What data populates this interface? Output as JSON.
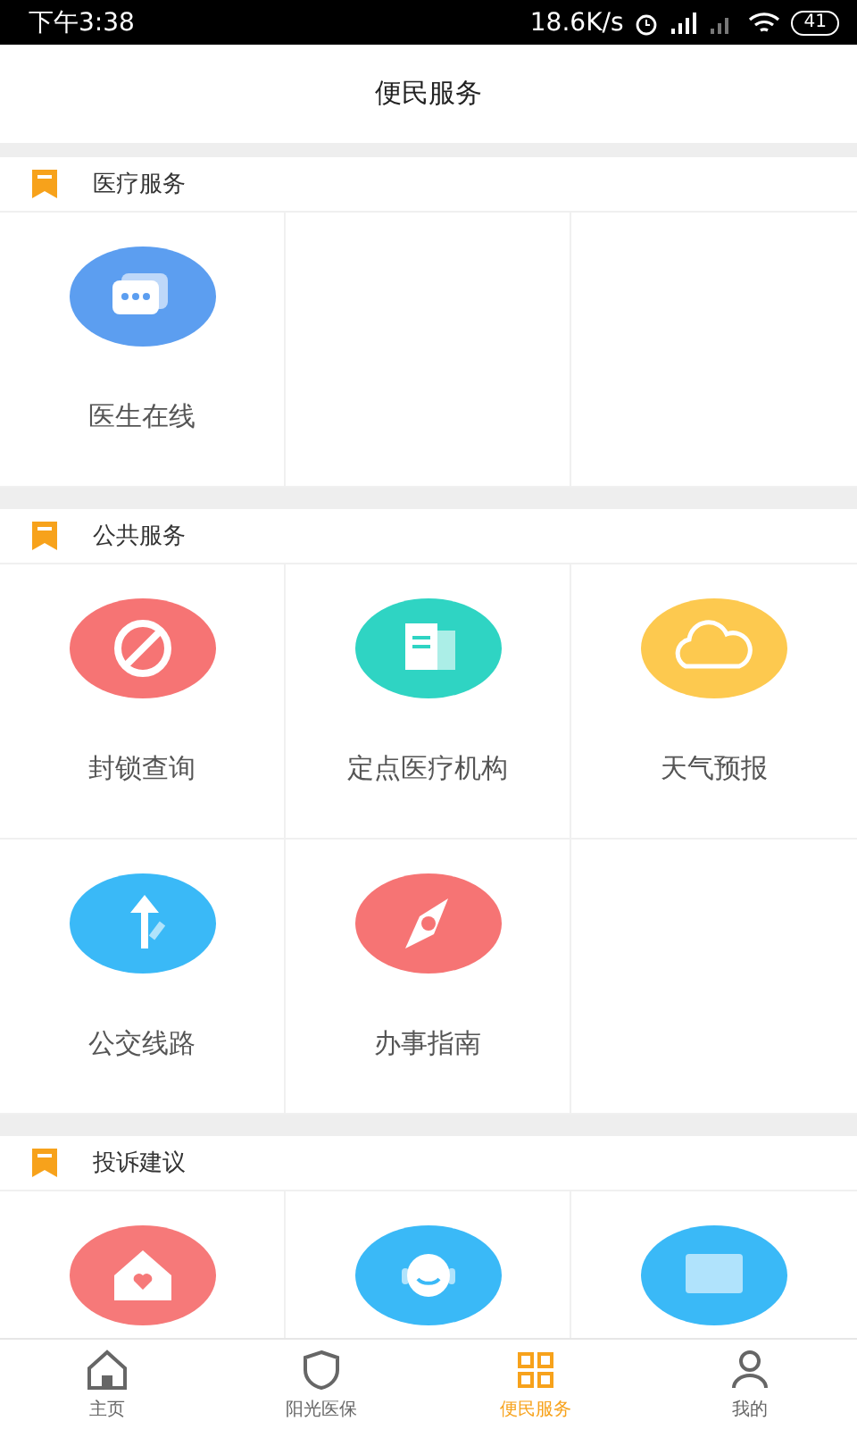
{
  "status_bar": {
    "time": "下午3:38",
    "speed": "18.6K/s",
    "battery": "41"
  },
  "header": {
    "title": "便民服务"
  },
  "sections": [
    {
      "title": "医疗服务",
      "items": [
        {
          "kind": "chat",
          "label": "医生在线"
        }
      ]
    },
    {
      "title": "公共服务",
      "items": [
        {
          "kind": "block",
          "label": "封锁查询"
        },
        {
          "kind": "hospital",
          "label": "定点医疗机构"
        },
        {
          "kind": "weather",
          "label": "天气预报"
        },
        {
          "kind": "bus",
          "label": "公交线路"
        },
        {
          "kind": "compass",
          "label": "办事指南"
        }
      ]
    },
    {
      "title": "投诉建议",
      "items": [
        {
          "kind": "house"
        },
        {
          "kind": "agent"
        },
        {
          "kind": "screen"
        }
      ]
    }
  ],
  "tabs": [
    {
      "kind": "home",
      "label": "主页",
      "selected": false
    },
    {
      "kind": "shield",
      "label": "阳光医保",
      "selected": false
    },
    {
      "kind": "service",
      "label": "便民服务",
      "selected": true
    },
    {
      "kind": "user",
      "label": "我的",
      "selected": false
    }
  ]
}
